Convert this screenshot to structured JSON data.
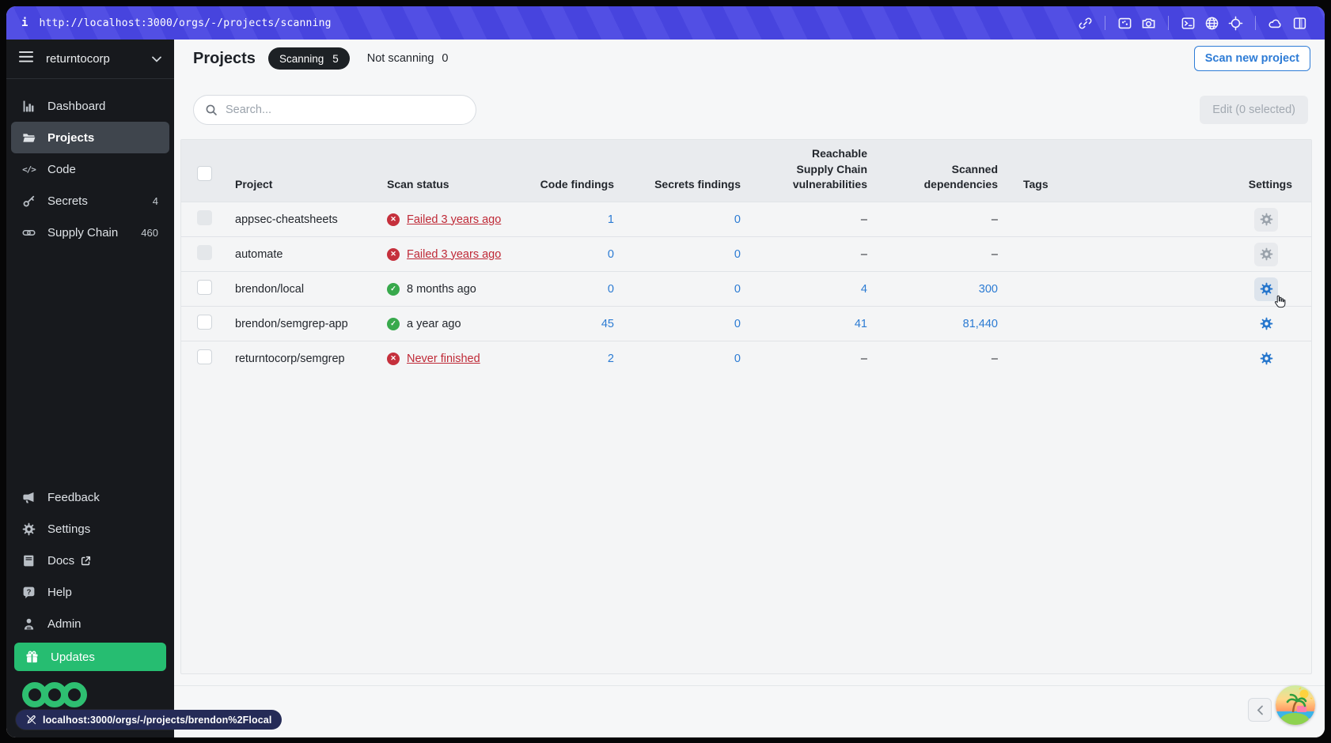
{
  "browser": {
    "info_symbol": "i",
    "url": "http://localhost:3000/orgs/-/projects/scanning",
    "link_preview": "localhost:3000/orgs/-/projects/brendon%2Flocal"
  },
  "sidebar": {
    "org_name": "returntocorp",
    "nav": [
      {
        "label": "Dashboard",
        "badge": ""
      },
      {
        "label": "Projects",
        "badge": ""
      },
      {
        "label": "Code",
        "badge": ""
      },
      {
        "label": "Secrets",
        "badge": "4"
      },
      {
        "label": "Supply Chain",
        "badge": "460"
      }
    ],
    "footer_nav": [
      {
        "label": "Feedback"
      },
      {
        "label": "Settings"
      },
      {
        "label": "Docs"
      },
      {
        "label": "Help"
      },
      {
        "label": "Admin"
      },
      {
        "label": "Updates"
      }
    ]
  },
  "header": {
    "title": "Projects",
    "scanning_label": "Scanning",
    "scanning_count": "5",
    "not_scanning_label": "Not scanning",
    "not_scanning_count": "0",
    "scan_new_project_button": "Scan new project"
  },
  "toolbar": {
    "search_placeholder": "Search...",
    "edit_button": "Edit (0 selected)"
  },
  "table": {
    "header": {
      "project": "Project",
      "scan_status": "Scan status",
      "code_findings": "Code findings",
      "secrets_findings": "Secrets findings",
      "reachable_vulns": "Reachable Supply Chain vulnerabilities",
      "scanned_deps": "Scanned dependencies",
      "tags": "Tags",
      "settings": "Settings"
    },
    "rows": [
      {
        "project": "appsec-cheatsheets",
        "status_text": "Failed 3 years ago",
        "status": "failed",
        "code_findings": "1",
        "secrets_findings": "0",
        "reachable_vulns": "–",
        "scanned_deps": "–",
        "tags": ""
      },
      {
        "project": "automate",
        "status_text": "Failed 3 years ago",
        "status": "failed",
        "code_findings": "0",
        "secrets_findings": "0",
        "reachable_vulns": "–",
        "scanned_deps": "–",
        "tags": ""
      },
      {
        "project": "brendon/local",
        "status_text": "8 months ago",
        "status": "success",
        "code_findings": "0",
        "secrets_findings": "0",
        "reachable_vulns": "4",
        "scanned_deps": "300",
        "tags": ""
      },
      {
        "project": "brendon/semgrep-app",
        "status_text": "a year ago",
        "status": "success",
        "code_findings": "45",
        "secrets_findings": "0",
        "reachable_vulns": "41",
        "scanned_deps": "81,440",
        "tags": ""
      },
      {
        "project": "returntocorp/semgrep",
        "status_text": "Never finished",
        "status": "failed",
        "code_findings": "2",
        "secrets_findings": "0",
        "reachable_vulns": "–",
        "scanned_deps": "–",
        "tags": ""
      }
    ]
  },
  "pagination": {
    "prev": "‹"
  },
  "colors": {
    "topbar_purple": "#4845e2",
    "sidebar_bg": "#17191d",
    "updates_green": "#26bd71",
    "logo_green": "#2ebf71",
    "accent_blue": "#2e7cd6",
    "link_blue": "#2b7bd3",
    "failed_red": "#c5303c",
    "success_green": "#38a94c"
  }
}
